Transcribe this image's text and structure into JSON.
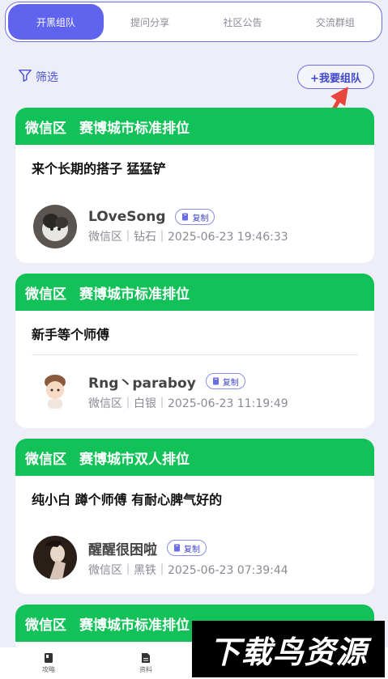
{
  "tabs": [
    "开黑组队",
    "提问分享",
    "社区公告",
    "交流群组"
  ],
  "filter_label": "筛选",
  "team_button": "+我要组队",
  "copy_label": "复制",
  "cards": [
    {
      "region": "微信区",
      "mode": "赛博城市标准排位",
      "title": "来个长期的搭子 猛猛铲",
      "user": "LOveSong",
      "meta": "微信区｜钻石｜2025-06-23 19:46:33"
    },
    {
      "region": "微信区",
      "mode": "赛博城市标准排位",
      "title": "新手等个师傅",
      "user": "Rng丶paraboy",
      "meta": "微信区｜白银｜2025-06-23 11:19:49"
    },
    {
      "region": "微信区",
      "mode": "赛博城市双人排位",
      "title": "纯小白 蹲个师傅 有耐心脾气好的",
      "user": "醒醒很困啦",
      "meta": "微信区｜黑铁｜2025-06-23 07:39:44"
    },
    {
      "region": "微信区",
      "mode": "赛博城市标准排位"
    }
  ],
  "bottom_nav": [
    "攻略",
    "资料"
  ],
  "watermark": "下载鸟资源",
  "colors": {
    "accent": "#5f63ee",
    "card_header": "#12c158",
    "background": "#eeeef8"
  }
}
